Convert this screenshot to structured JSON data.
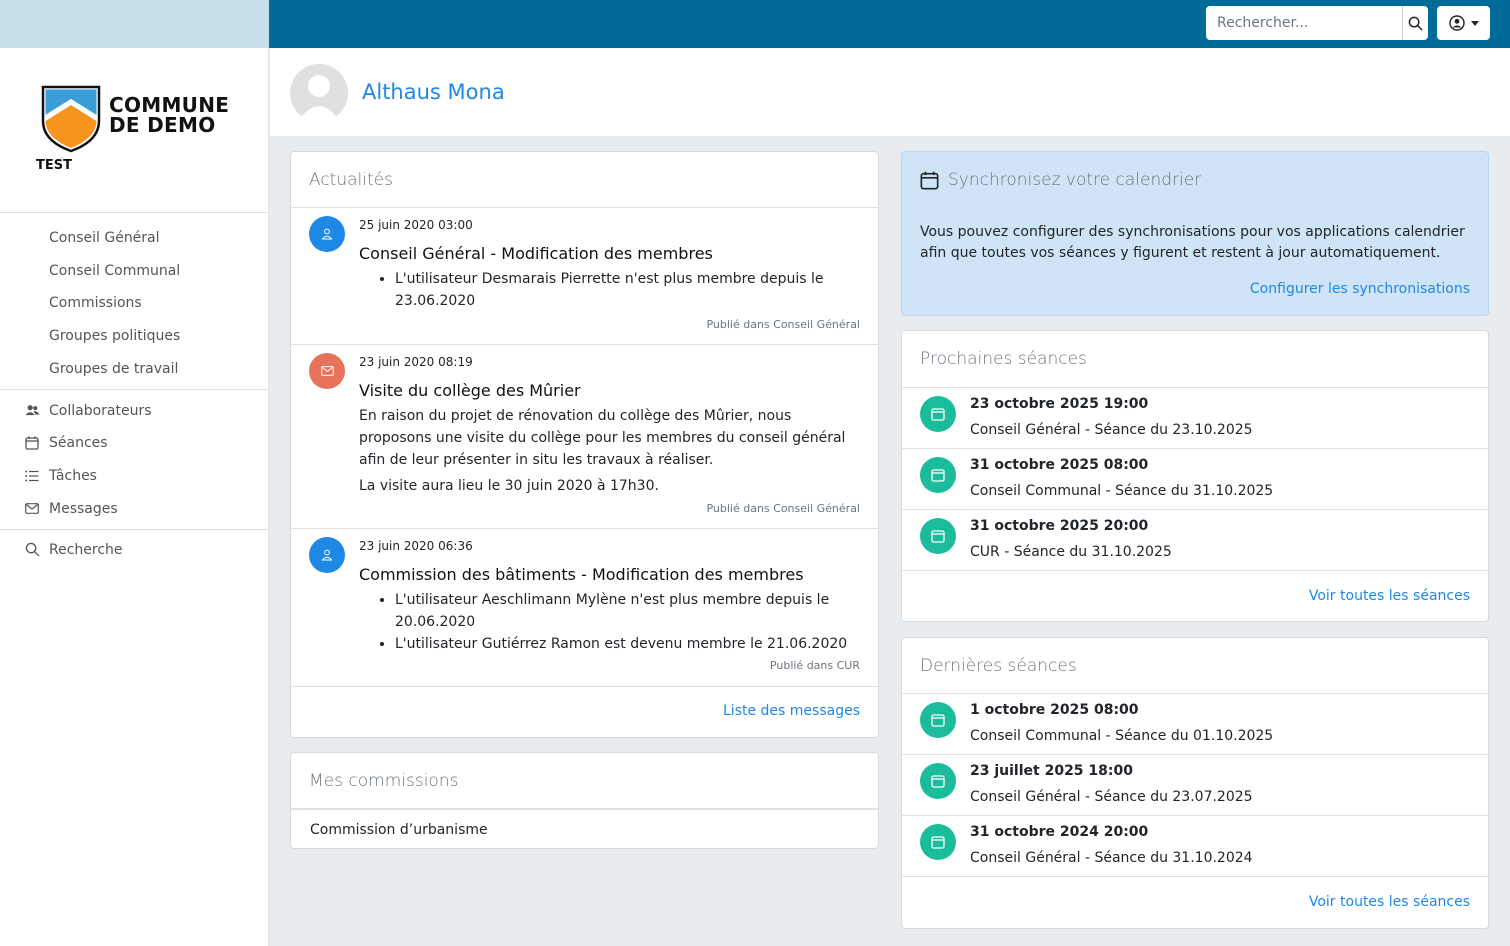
{
  "header": {
    "search_placeholder": "Rechercher..."
  },
  "sidebar": {
    "logo_line1": "COMMUNE",
    "logo_line2": "DE DEMO",
    "env_badge": "TEST",
    "groups": [
      {
        "label": "Conseil Général"
      },
      {
        "label": "Conseil Communal"
      },
      {
        "label": "Commissions"
      },
      {
        "label": "Groupes politiques"
      },
      {
        "label": "Groupes de travail"
      }
    ],
    "nav": [
      {
        "label": "Collaborateurs",
        "icon": "users-icon"
      },
      {
        "label": "Séances",
        "icon": "calendar-icon"
      },
      {
        "label": "Tâches",
        "icon": "list-icon"
      },
      {
        "label": "Messages",
        "icon": "envelope-icon"
      }
    ],
    "search": {
      "label": "Recherche",
      "icon": "search-icon"
    }
  },
  "profile": {
    "name": "Althaus Mona"
  },
  "news": {
    "title": "Actualités",
    "items": [
      {
        "date": "25 juin 2020 03:00",
        "title": "Conseil Général - Modification des membres",
        "bullets": [
          "L'utilisateur Desmarais Pierrette n'est plus membre depuis le 23.06.2020"
        ],
        "published": "Publié dans Conseil Général",
        "icon": "user-icon",
        "color": "#1e88e5"
      },
      {
        "date": "23 juin 2020 08:19",
        "title": "Visite du collège des Mûrier",
        "paragraphs": [
          "En raison du projet de rénovation du collège des Mûrier, nous proposons une visite du collège pour les membres du conseil général afin de leur présenter in situ les travaux à réaliser.",
          "La visite aura lieu le 30 juin 2020 à 17h30."
        ],
        "published": "Publié dans Conseil Général",
        "icon": "envelope-icon",
        "color": "#e8725c"
      },
      {
        "date": "23 juin 2020 06:36",
        "title": "Commission des bâtiments - Modification des membres",
        "bullets": [
          "L'utilisateur Aeschlimann Mylène n'est plus membre depuis le 20.06.2020",
          "L'utilisateur Gutiérrez Ramon est devenu membre le 21.06.2020"
        ],
        "published": "Publié dans CUR",
        "icon": "user-icon",
        "color": "#1e88e5"
      }
    ],
    "link": "Liste des messages"
  },
  "commissions": {
    "title": "Mes commissions",
    "items": [
      "Commission d’urbanisme"
    ]
  },
  "sync": {
    "title": "Synchronisez votre calendrier",
    "text": "Vous pouvez configurer des synchronisations pour vos applications calendrier afin que toutes vos séances y figurent et restent à jour automatiquement.",
    "link": "Configurer les synchronisations"
  },
  "upcoming": {
    "title": "Prochaines séances",
    "items": [
      {
        "date": "23 octobre 2025 19:00",
        "name": "Conseil Général - Séance du 23.10.2025"
      },
      {
        "date": "31 octobre 2025 08:00",
        "name": "Conseil Communal - Séance du 31.10.2025"
      },
      {
        "date": "31 octobre 2025 20:00",
        "name": "CUR - Séance du 31.10.2025"
      }
    ],
    "link": "Voir toutes les séances"
  },
  "past": {
    "title": "Dernières séances",
    "items": [
      {
        "date": "1 octobre 2025 08:00",
        "name": "Conseil Communal - Séance du 01.10.2025"
      },
      {
        "date": "23 juillet 2025 18:00",
        "name": "Conseil Général - Séance du 23.07.2025"
      },
      {
        "date": "31 octobre 2024 20:00",
        "name": "Conseil Général - Séance du 31.10.2024"
      }
    ],
    "link": "Voir toutes les séances"
  },
  "colors": {
    "topbar": "#006a99",
    "accent": "#1e88e5",
    "seance": "#1abc9c"
  }
}
